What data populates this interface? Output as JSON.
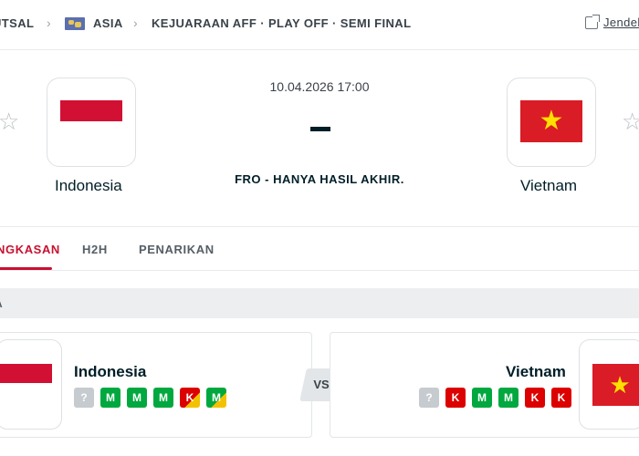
{
  "breadcrumb": {
    "sport": "UTSAL",
    "region": "ASIA",
    "competition": "KEJUARAAN AFF · PLAY OFF · SEMI FINAL",
    "window_link": "Jendel"
  },
  "match": {
    "datetime": "10.04.2026 17:00",
    "score": "-",
    "status": "FRO - HANYA HASIL AKHIR.",
    "home": {
      "name": "Indonesia",
      "flag": "indonesia-flag-icon"
    },
    "away": {
      "name": "Vietnam",
      "flag": "vietnam-flag-icon"
    }
  },
  "tabs": [
    {
      "label": "NGKASAN",
      "active": true
    },
    {
      "label": "H2H",
      "active": false
    },
    {
      "label": "PENARIKAN",
      "active": false
    }
  ],
  "section": {
    "label": "A"
  },
  "form": {
    "home": {
      "name": "Indonesia",
      "results": [
        "?",
        "M",
        "M",
        "M",
        "K",
        "M"
      ]
    },
    "vs_label": "VS",
    "away": {
      "name": "Vietnam",
      "results": [
        "?",
        "K",
        "M",
        "M",
        "K",
        "K"
      ]
    }
  },
  "colors": {
    "accent": "#c8102e",
    "win": "#00a83f",
    "loss": "#dc0000",
    "unknown": "#c6cbcf",
    "indonesia_red": "#d21033",
    "vietnam_red": "#da1c26",
    "vietnam_star": "#ffe000"
  }
}
